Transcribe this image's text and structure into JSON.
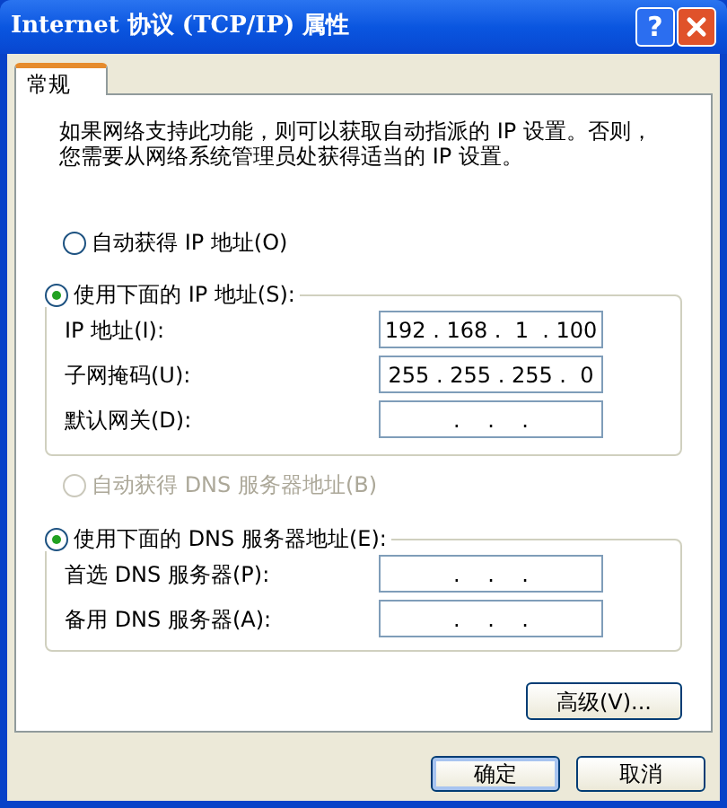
{
  "window": {
    "title": "Internet 协议 (TCP/IP) 属性",
    "help": "?"
  },
  "tabs": [
    {
      "label": "常规",
      "selected": true
    }
  ],
  "description": "如果网络支持此功能，则可以获取自动指派的 IP 设置。否则，您需要从网络系统管理员处获得适当的 IP 设置。",
  "ip_section": {
    "options": [
      {
        "label": "自动获得 IP 地址(O)",
        "selected": false,
        "disabled": false
      },
      {
        "label": "使用下面的 IP 地址(S):",
        "selected": true,
        "disabled": false
      }
    ],
    "fields": [
      {
        "label": "IP 地址(I):",
        "value": "192 . 168 .  1  . 100"
      },
      {
        "label": "子网掩码(U):",
        "value": "255 . 255 . 255 .  0"
      },
      {
        "label": "默认网关(D):",
        "value": " .    .    . "
      }
    ]
  },
  "dns_section": {
    "options": [
      {
        "label": "自动获得 DNS 服务器地址(B)",
        "selected": false,
        "disabled": true
      },
      {
        "label": "使用下面的 DNS 服务器地址(E):",
        "selected": true,
        "disabled": false
      }
    ],
    "fields": [
      {
        "label": "首选 DNS 服务器(P):",
        "value": " .    .    . "
      },
      {
        "label": "备用 DNS 服务器(A):",
        "value": " .    .    . "
      }
    ]
  },
  "advanced_button": "高级(V)...",
  "buttons": [
    "确定",
    "取消"
  ]
}
